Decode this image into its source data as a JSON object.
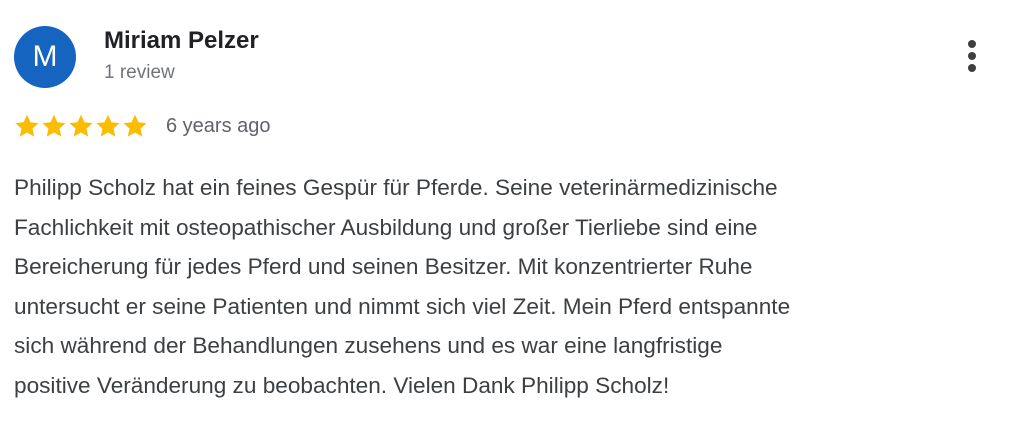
{
  "reviewer": {
    "initial": "M",
    "name": "Miriam Pelzer",
    "review_count": "1 review",
    "avatar_color": "#1565c0"
  },
  "rating": {
    "stars": 5,
    "max_stars": 5,
    "star_color": "#fbbc04",
    "icon": "star-icon"
  },
  "date": "6 years ago",
  "menu": {
    "icon": "more-vert-icon"
  },
  "review": {
    "lines": [
      "Philipp Scholz hat ein feines Gespür für Pferde. Seine veterinärmedizinische",
      "Fachlichkeit mit osteopathischer Ausbildung und großer Tierliebe sind eine",
      "Bereicherung für jedes Pferd und seinen Besitzer. Mit konzentrierter Ruhe",
      "untersucht er seine Patienten und nimmt sich viel Zeit. Mein Pferd entspannte",
      "sich während der Behandlungen zusehens und es war eine langfristige",
      "positive Veränderung zu beobachten. Vielen Dank Philipp Scholz!"
    ]
  }
}
